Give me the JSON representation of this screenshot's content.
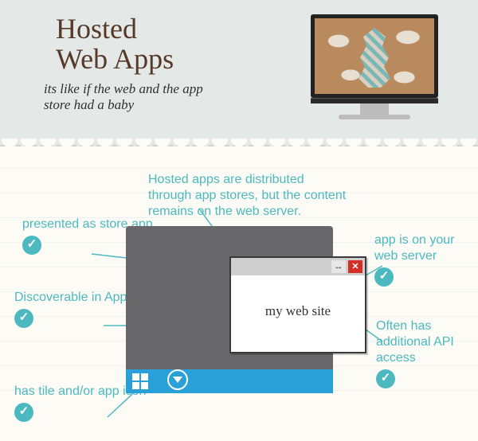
{
  "header": {
    "title_line1": "Hosted",
    "title_line2": "Web Apps",
    "subtitle": "its like if the web and the app store had a baby"
  },
  "intro": "Hosted apps are distributed through app stores, but the content remains on the web server.",
  "window": {
    "body_text": "my web site",
    "resize_glyph": "↔",
    "close_glyph": "✕"
  },
  "checkmark_glyph": "✓",
  "annotations": {
    "left": [
      {
        "text": "presented as store app"
      },
      {
        "text": "Discoverable in App Store"
      },
      {
        "text": "has tile and/or app icon"
      }
    ],
    "right": [
      {
        "text": "app is on your web server"
      },
      {
        "text": "Often has additional API access"
      }
    ]
  },
  "colors": {
    "accent": "#4cb9c0",
    "desk": "#676769",
    "taskbar": "#2aa0d8",
    "title": "#553a28",
    "close": "#d42e25"
  }
}
